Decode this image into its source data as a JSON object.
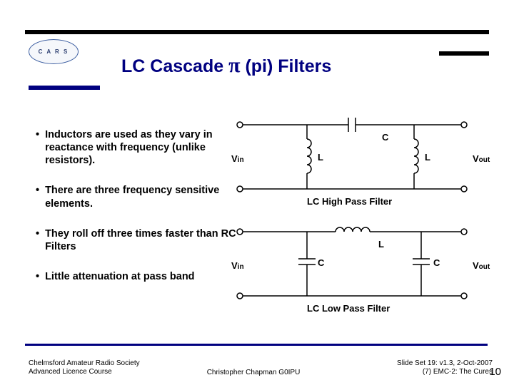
{
  "logo_text": "C A R S",
  "title_pre": "LC Cascade ",
  "title_pi": "π",
  "title_post": " (pi) Filters",
  "bullets": [
    "Inductors are used as they vary in reactance with frequency (unlike resistors).",
    "There are three frequency sensitive elements.",
    "They roll off three times faster than RC Filters",
    "Little attenuation at pass band"
  ],
  "hp": {
    "vin": "V",
    "vin_sub": "in",
    "l1": "L",
    "c": "C",
    "l2": "L",
    "vout": "V",
    "vout_sub": "out",
    "caption": "LC High Pass Filter"
  },
  "lp": {
    "vin": "V",
    "vin_sub": "in",
    "c1": "C",
    "l": "L",
    "c2": "C",
    "vout": "V",
    "vout_sub": "out",
    "caption": "LC Low Pass Filter"
  },
  "footer": {
    "left1": "Chelmsford Amateur Radio Society",
    "left2": "Advanced Licence Course",
    "mid": "Christopher Chapman G0IPU",
    "right1": "Slide Set 19:  v1.3,  2-Oct-2007",
    "right2": "(7) EMC-2: The Cures"
  },
  "page": "10"
}
